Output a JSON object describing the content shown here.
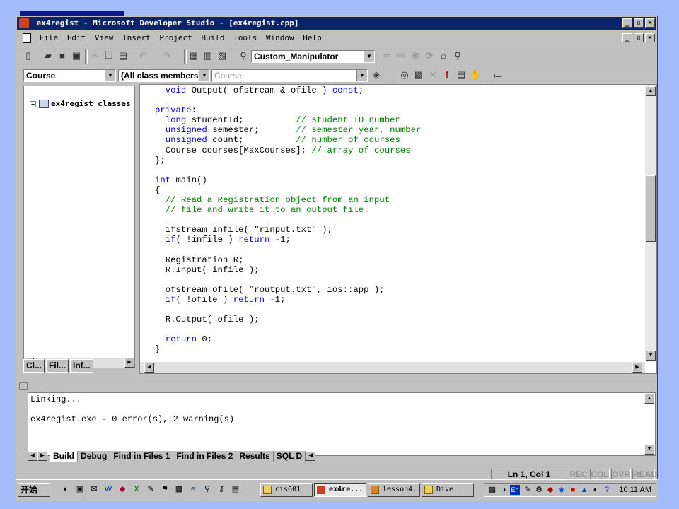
{
  "window": {
    "title": "ex4regist - Microsoft Developer Studio - [ex4regist.cpp]"
  },
  "menu": [
    "File",
    "Edit",
    "View",
    "Insert",
    "Project",
    "Build",
    "Tools",
    "Window",
    "Help"
  ],
  "toolbar": {
    "find_combo_value": "Custom_Manipulator",
    "class_combo_value": "Course",
    "filter_combo_value": "(All class members)",
    "member_combo_value": "Course"
  },
  "workspace": {
    "tree_root_label": "ex4regist classes",
    "tabs": [
      "Cl...",
      "Fil...",
      "Inf..."
    ]
  },
  "editor": {
    "lines": [
      [
        {
          "t": "  "
        },
        {
          "t": "void",
          "c": "kw"
        },
        {
          "t": " Output( ofstream & ofile ) "
        },
        {
          "t": "const",
          "c": "kw"
        },
        {
          "t": ";"
        }
      ],
      [],
      [
        {
          "t": "private",
          "c": "kw"
        },
        {
          "t": ":"
        }
      ],
      [
        {
          "t": "  "
        },
        {
          "t": "long",
          "c": "kw"
        },
        {
          "t": " studentId;          "
        },
        {
          "t": "// student ID number",
          "c": "cm"
        }
      ],
      [
        {
          "t": "  "
        },
        {
          "t": "unsigned",
          "c": "kw"
        },
        {
          "t": " semester;       "
        },
        {
          "t": "// semester year, number",
          "c": "cm"
        }
      ],
      [
        {
          "t": "  "
        },
        {
          "t": "unsigned",
          "c": "kw"
        },
        {
          "t": " count;          "
        },
        {
          "t": "// number of courses",
          "c": "cm"
        }
      ],
      [
        {
          "t": "  Course courses[MaxCourses]; "
        },
        {
          "t": "// array of courses",
          "c": "cm"
        }
      ],
      [
        {
          "t": "};"
        }
      ],
      [],
      [
        {
          "t": "int",
          "c": "kw"
        },
        {
          "t": " main()"
        }
      ],
      [
        {
          "t": "{"
        }
      ],
      [
        {
          "t": "  "
        },
        {
          "t": "// Read a Registration object from an input",
          "c": "cm"
        }
      ],
      [
        {
          "t": "  "
        },
        {
          "t": "// file and write it to an output file.",
          "c": "cm"
        }
      ],
      [],
      [
        {
          "t": "  ifstream infile( \"rinput.txt\" );"
        }
      ],
      [
        {
          "t": "  "
        },
        {
          "t": "if",
          "c": "kw"
        },
        {
          "t": "( !infile ) "
        },
        {
          "t": "return",
          "c": "kw"
        },
        {
          "t": " -1;"
        }
      ],
      [],
      [
        {
          "t": "  Registration R;"
        }
      ],
      [
        {
          "t": "  R.Input( infile );"
        }
      ],
      [],
      [
        {
          "t": "  ofstream ofile( \"routput.txt\", ios::app );"
        }
      ],
      [
        {
          "t": "  "
        },
        {
          "t": "if",
          "c": "kw"
        },
        {
          "t": "( !ofile ) "
        },
        {
          "t": "return",
          "c": "kw"
        },
        {
          "t": " -1;"
        }
      ],
      [],
      [
        {
          "t": "  R.Output( ofile );"
        }
      ],
      [],
      [
        {
          "t": "  "
        },
        {
          "t": "return",
          "c": "kw"
        },
        {
          "t": " 0;"
        }
      ],
      [
        {
          "t": "}"
        }
      ]
    ]
  },
  "output": {
    "lines": [
      "Linking...",
      "",
      "ex4regist.exe - 0 error(s), 2 warning(s)"
    ],
    "tabs": [
      "Build",
      "Debug",
      "Find in Files 1",
      "Find in Files 2",
      "Results",
      "SQL D"
    ]
  },
  "status": {
    "position": "Ln 1, Col 1",
    "rec": "REC",
    "col": "COL",
    "ovr": "OVR",
    "read": "READ"
  },
  "taskbar": {
    "start_label": "开始",
    "tasks": [
      "cis601",
      "ex4re...",
      "lesson4...",
      "Dive"
    ],
    "clock": "10:11 AM"
  }
}
